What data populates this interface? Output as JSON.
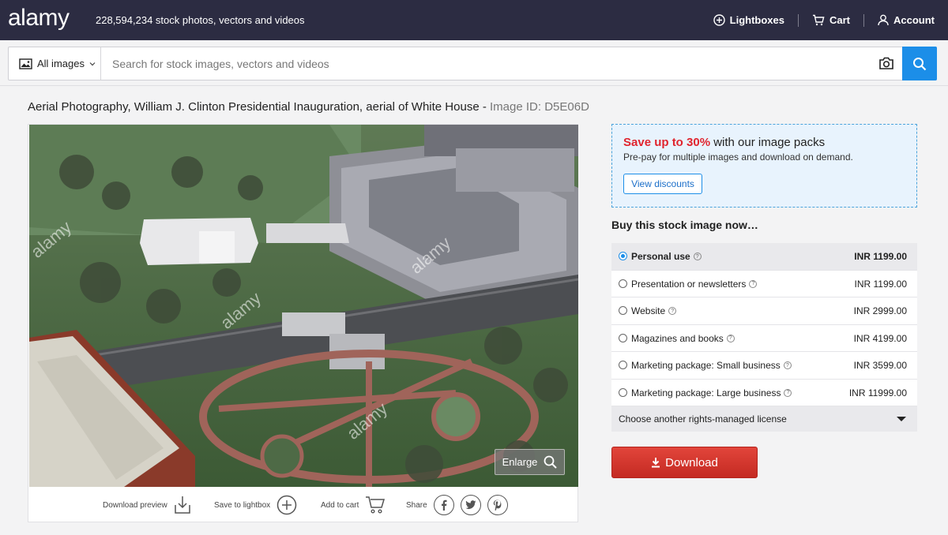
{
  "header": {
    "logo": "alamy",
    "tagline": "228,594,234 stock photos, vectors and videos",
    "nav": [
      {
        "label": "Lightboxes",
        "icon": "plus-circle-icon"
      },
      {
        "label": "Cart",
        "icon": "cart-icon"
      },
      {
        "label": "Account",
        "icon": "user-icon"
      }
    ]
  },
  "search": {
    "scope_label": "All images",
    "placeholder": "Search for stock images, vectors and videos",
    "value": ""
  },
  "image": {
    "title": "Aerial Photography, William J. Clinton Presidential Inauguration, aerial of White House -",
    "id_label": "Image ID: D5E06D",
    "watermark": "alamy",
    "enlarge_label": "Enlarge"
  },
  "actions": {
    "download_preview": "Download preview",
    "save_to_lightbox": "Save to lightbox",
    "add_to_cart": "Add to cart",
    "share": "Share"
  },
  "promo": {
    "highlight": "Save up to 30%",
    "rest": "with our image packs",
    "sub": "Pre-pay for multiple images and download on demand.",
    "button": "View discounts"
  },
  "buy": {
    "heading": "Buy this stock image now…",
    "licenses": [
      {
        "label": "Personal use",
        "price": "INR 1199.00",
        "selected": true
      },
      {
        "label": "Presentation or newsletters",
        "price": "INR 1199.00",
        "selected": false
      },
      {
        "label": "Website",
        "price": "INR 2999.00",
        "selected": false
      },
      {
        "label": "Magazines and books",
        "price": "INR 4199.00",
        "selected": false
      },
      {
        "label": "Marketing package: Small business",
        "price": "INR 3599.00",
        "selected": false
      },
      {
        "label": "Marketing package: Large business",
        "price": "INR 11999.00",
        "selected": false
      }
    ],
    "other_license": "Choose another rights-managed license",
    "download_label": "Download"
  },
  "colors": {
    "topbar": "#2c2c42",
    "accent_blue": "#1c8ee8",
    "download_red": "#d2352c",
    "promo_red": "#e0242e"
  }
}
